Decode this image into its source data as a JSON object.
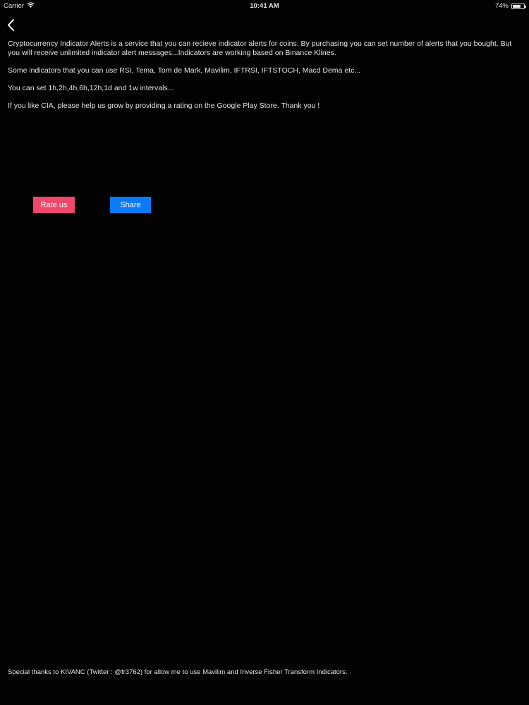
{
  "status_bar": {
    "carrier": "Carrier",
    "time": "10:41 AM",
    "battery_percent": "74%",
    "battery_level": 0.74
  },
  "nav": {
    "back_icon": "chevron-left-icon"
  },
  "content": {
    "paragraphs": [
      "Cryptocurrency Indicator Alerts is a service that you can recieve indicator alerts for coins. By purchasing you can set number of alerts that you bought. But you will receive unlimited indicator alert messages...Indicators are working based on Binance Klines.",
      "Some indicators that you can use RSI, Tema, Tom de Mark, Mavilim, IFTRSI, IFTSTOCH, Macd Dema etc...",
      "You can set 1h,2h,4h,6h,12h,1d and 1w intervals...",
      "If you like CIA, please help us grow by providing a rating on the Google Play Store. Thank you !"
    ]
  },
  "actions": {
    "rate_label": "Rate us",
    "share_label": "Share",
    "rate_color": "#f0476c",
    "share_color": "#0a7af8"
  },
  "footer": {
    "text": "Special thanks to KIVANC (Twitter : @fr3762) for allow me to use Mavilim and Inverse Fisher Transform Indicators."
  }
}
